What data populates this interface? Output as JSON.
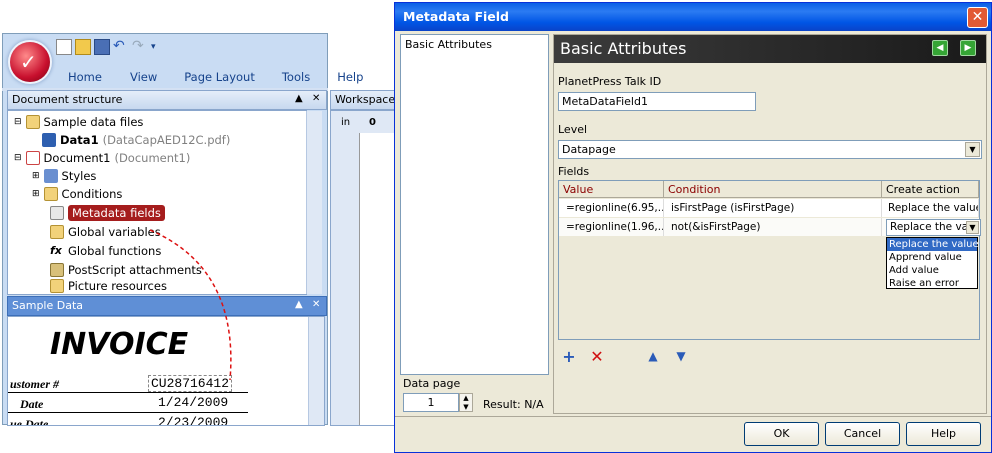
{
  "app": {
    "ribbon_tabs": [
      "Home",
      "View",
      "Page Layout",
      "Tools",
      "Help"
    ],
    "doc_structure_title": "Document structure",
    "workspace_title": "Workspace",
    "ruler_unit": "in",
    "ruler_zero": "0",
    "tree": [
      {
        "label": "Sample data files",
        "sub": ""
      },
      {
        "label": "Data1",
        "sub": "(DataCapAED12C.pdf)"
      },
      {
        "label": "Document1",
        "sub": "(Document1)"
      },
      {
        "label": "Styles",
        "sub": ""
      },
      {
        "label": "Conditions",
        "sub": ""
      },
      {
        "label": "Metadata fields",
        "sub": ""
      },
      {
        "label": "Global variables",
        "sub": ""
      },
      {
        "label": "Global functions",
        "sub": ""
      },
      {
        "label": "PostScript attachments",
        "sub": ""
      },
      {
        "label": "Picture resources",
        "sub": ""
      }
    ],
    "sample_data_title": "Sample Data",
    "invoice": {
      "title": "INVOICE",
      "customer_label": "ustomer #",
      "customer_value": "CU28716412",
      "date_label": "Date",
      "date_value": "1/24/2009",
      "due_label": "ue Date",
      "due_value": "2/23/2009"
    }
  },
  "dialog": {
    "title": "Metadata Field",
    "close_glyph": "✕",
    "left_list": [
      "Basic Attributes"
    ],
    "section_title": "Basic Attributes",
    "talk_id_label": "PlanetPress Talk ID",
    "talk_id_value": "MetaDataField1",
    "level_label": "Level",
    "level_value": "Datapage",
    "fields_label": "Fields",
    "columns": [
      "Value",
      "Condition",
      "Create action"
    ],
    "rows": [
      {
        "value": "=regionline(6.95,...",
        "condition": "isFirstPage (isFirstPage)",
        "action": "Replace the value"
      },
      {
        "value": "=regionline(1.96,...",
        "condition": "not(&isFirstPage)",
        "action": "Replace the val"
      }
    ],
    "dropdown_options": [
      "Replace the value",
      "Apprend value",
      "Add value",
      "Raise an error"
    ],
    "data_page_label": "Data page",
    "data_page_value": "1",
    "result_text": "Result: N/A",
    "ok_label": "OK",
    "cancel_label": "Cancel",
    "help_label": "Help"
  }
}
